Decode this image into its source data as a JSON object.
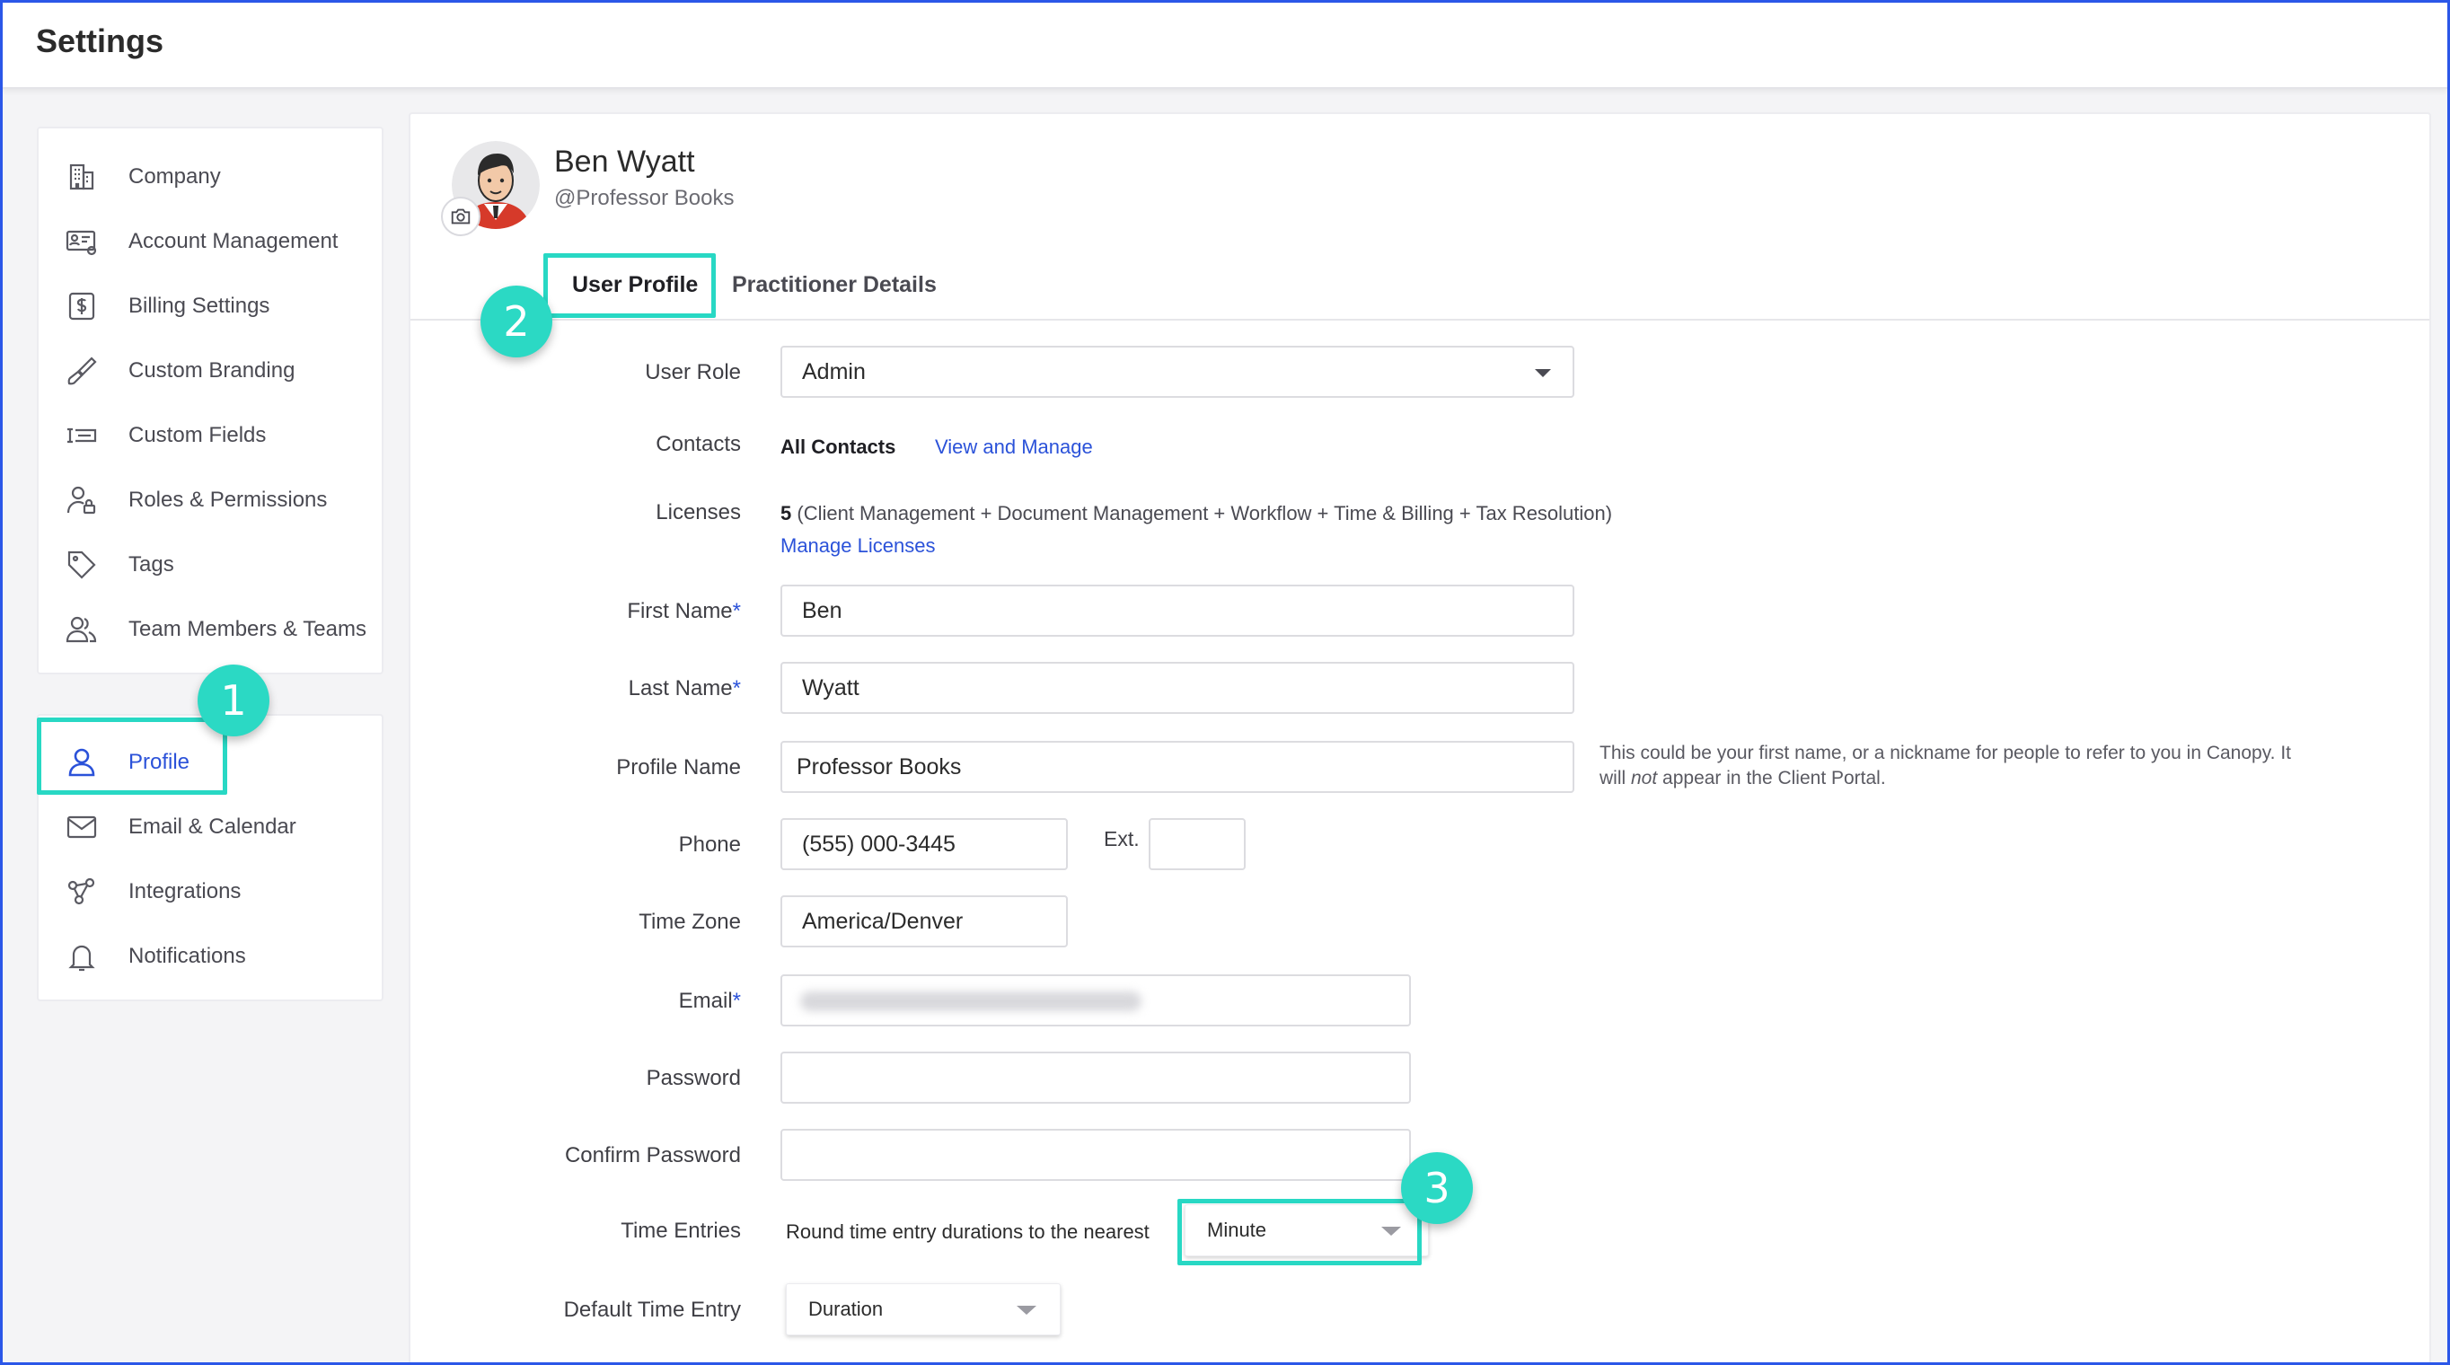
{
  "header": {
    "title": "Settings"
  },
  "sidebar": {
    "group1": [
      {
        "label": "Company",
        "icon": "building-icon"
      },
      {
        "label": "Account Management",
        "icon": "id-card-gear-icon"
      },
      {
        "label": "Billing Settings",
        "icon": "dollar-icon"
      },
      {
        "label": "Custom Branding",
        "icon": "paint-brush-icon"
      },
      {
        "label": "Custom Fields",
        "icon": "text-field-icon"
      },
      {
        "label": "Roles & Permissions",
        "icon": "user-lock-icon"
      },
      {
        "label": "Tags",
        "icon": "tag-icon"
      },
      {
        "label": "Team Members & Teams",
        "icon": "users-icon"
      }
    ],
    "group2": [
      {
        "label": "Profile",
        "icon": "user-icon",
        "active": true
      },
      {
        "label": "Email & Calendar",
        "icon": "envelope-icon"
      },
      {
        "label": "Integrations",
        "icon": "integrations-icon"
      },
      {
        "label": "Notifications",
        "icon": "bell-icon"
      }
    ]
  },
  "badges": {
    "one": "1",
    "two": "2",
    "three": "3"
  },
  "profile": {
    "name": "Ben Wyatt",
    "handle": "@Professor Books"
  },
  "tabs": {
    "user_profile": "User Profile",
    "practitioner_details": "Practitioner Details"
  },
  "form": {
    "user_role": {
      "label": "User Role",
      "value": "Admin"
    },
    "contacts": {
      "label": "Contacts",
      "value": "All Contacts",
      "link": "View and Manage"
    },
    "licenses": {
      "label": "Licenses",
      "count": "5",
      "detail": " (Client Management + Document Management + Workflow + Time & Billing + Tax Resolution)",
      "link": "Manage Licenses"
    },
    "first_name": {
      "label": "First Name",
      "required": "*",
      "value": "Ben"
    },
    "last_name": {
      "label": "Last Name",
      "required": "*",
      "value": "Wyatt"
    },
    "profile_name": {
      "label": "Profile Name",
      "value": "Professor Books",
      "hint_1": "This could be your first name, or a nickname for people to refer to you in Canopy. It",
      "hint_2a": "will ",
      "hint_2b": "not",
      "hint_2c": " appear in the Client Portal."
    },
    "phone": {
      "label": "Phone",
      "value": "(555) 000-3445",
      "ext_label": "Ext.",
      "ext_value": ""
    },
    "time_zone": {
      "label": "Time Zone",
      "value": "America/Denver"
    },
    "email": {
      "label": "Email",
      "required": "*"
    },
    "password": {
      "label": "Password",
      "value": ""
    },
    "confirm_password": {
      "label": "Confirm Password",
      "value": ""
    },
    "time_entries": {
      "label": "Time Entries",
      "text": "Round time entry durations to the nearest",
      "value": "Minute"
    },
    "default_time_entry": {
      "label": "Default Time Entry",
      "value": "Duration"
    }
  },
  "colors": {
    "accent": "#2b52d9",
    "highlight": "#28d8c4",
    "frame": "#2b57e8"
  }
}
